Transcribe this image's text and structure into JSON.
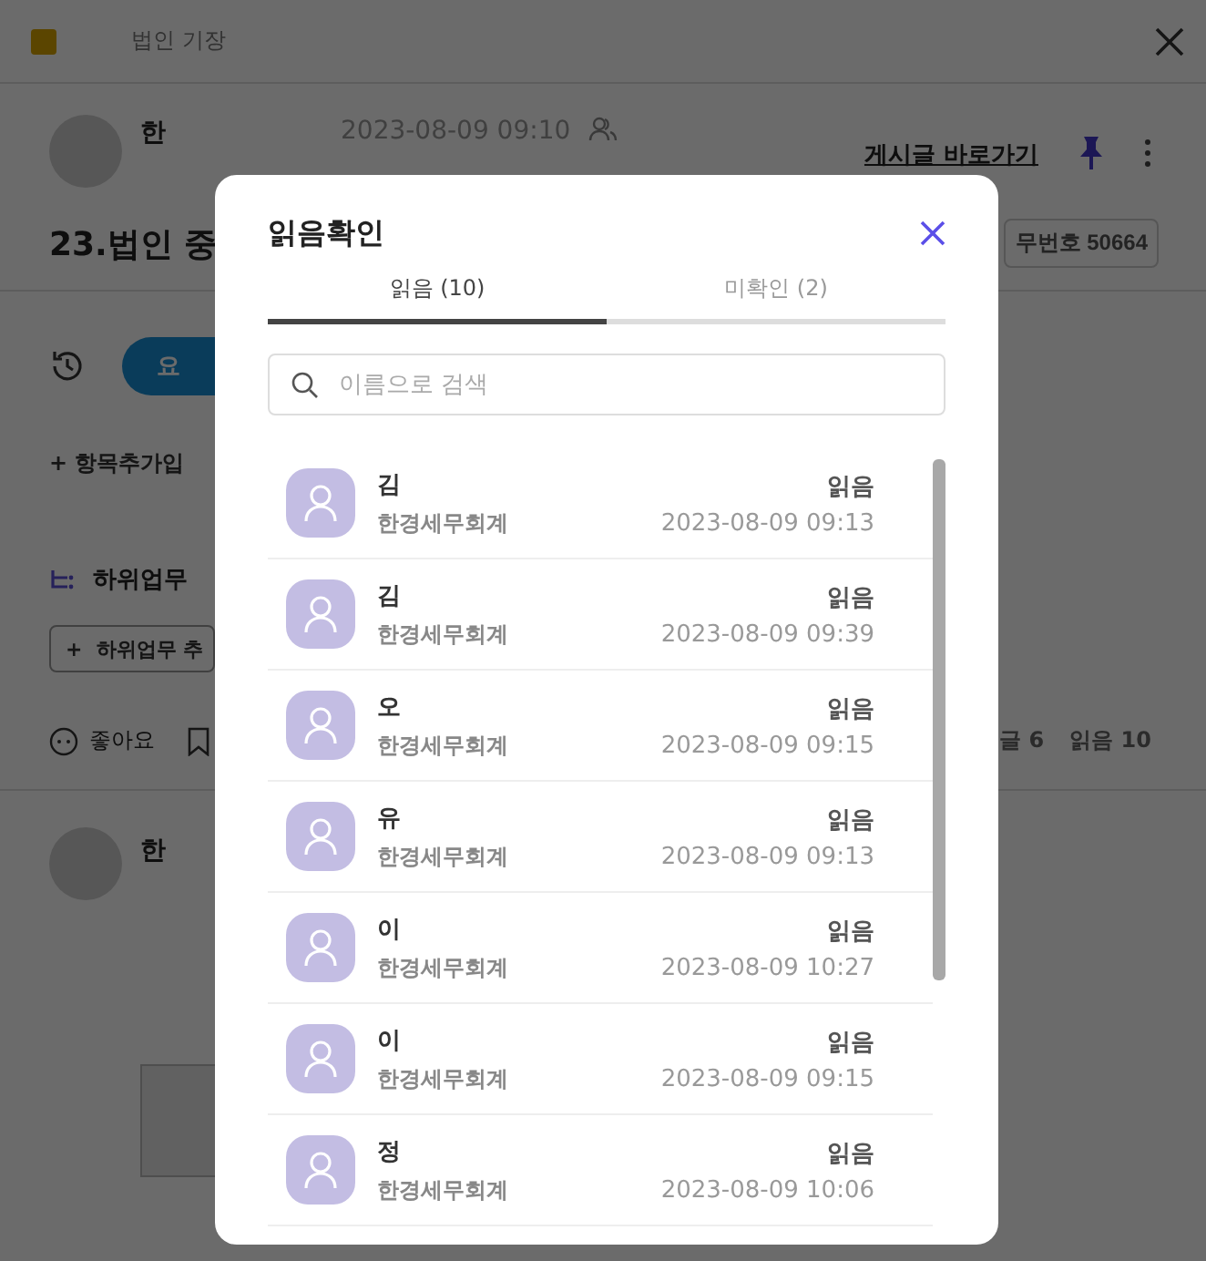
{
  "page": {
    "title": "법인 기장",
    "author": "한",
    "time": "2023-08-09 09:10",
    "post_link": "게시글 바로가기",
    "heading": "23.법인 중",
    "task_no": "무번호 50664",
    "request_button": "요",
    "add_item": "+ 항목추가입",
    "subtask_title": "하위업무",
    "add_subtask": "+  하위업무 추",
    "like": "좋아요",
    "comments": "글 6",
    "reads": "읽음 10",
    "comment_author": "한"
  },
  "dialog": {
    "title": "읽음확인",
    "tabs": [
      {
        "label": "읽음 (10)",
        "selected": true
      },
      {
        "label": "미확인 (2)",
        "selected": false
      }
    ],
    "search": {
      "placeholder": "이름으로 검색"
    },
    "readers": [
      {
        "name": "김",
        "org": "한경세무회계",
        "status": "읽음",
        "time": "2023-08-09 09:13"
      },
      {
        "name": "김",
        "org": "한경세무회계",
        "status": "읽음",
        "time": "2023-08-09 09:39"
      },
      {
        "name": "오",
        "org": "한경세무회계",
        "status": "읽음",
        "time": "2023-08-09 09:15"
      },
      {
        "name": "유",
        "org": "한경세무회계",
        "status": "읽음",
        "time": "2023-08-09 09:13"
      },
      {
        "name": "이",
        "org": "한경세무회계",
        "status": "읽음",
        "time": "2023-08-09 10:27"
      },
      {
        "name": "이",
        "org": "한경세무회계",
        "status": "읽음",
        "time": "2023-08-09 09:15"
      },
      {
        "name": "정",
        "org": "한경세무회계",
        "status": "읽음",
        "time": "2023-08-09 10:06"
      }
    ]
  }
}
